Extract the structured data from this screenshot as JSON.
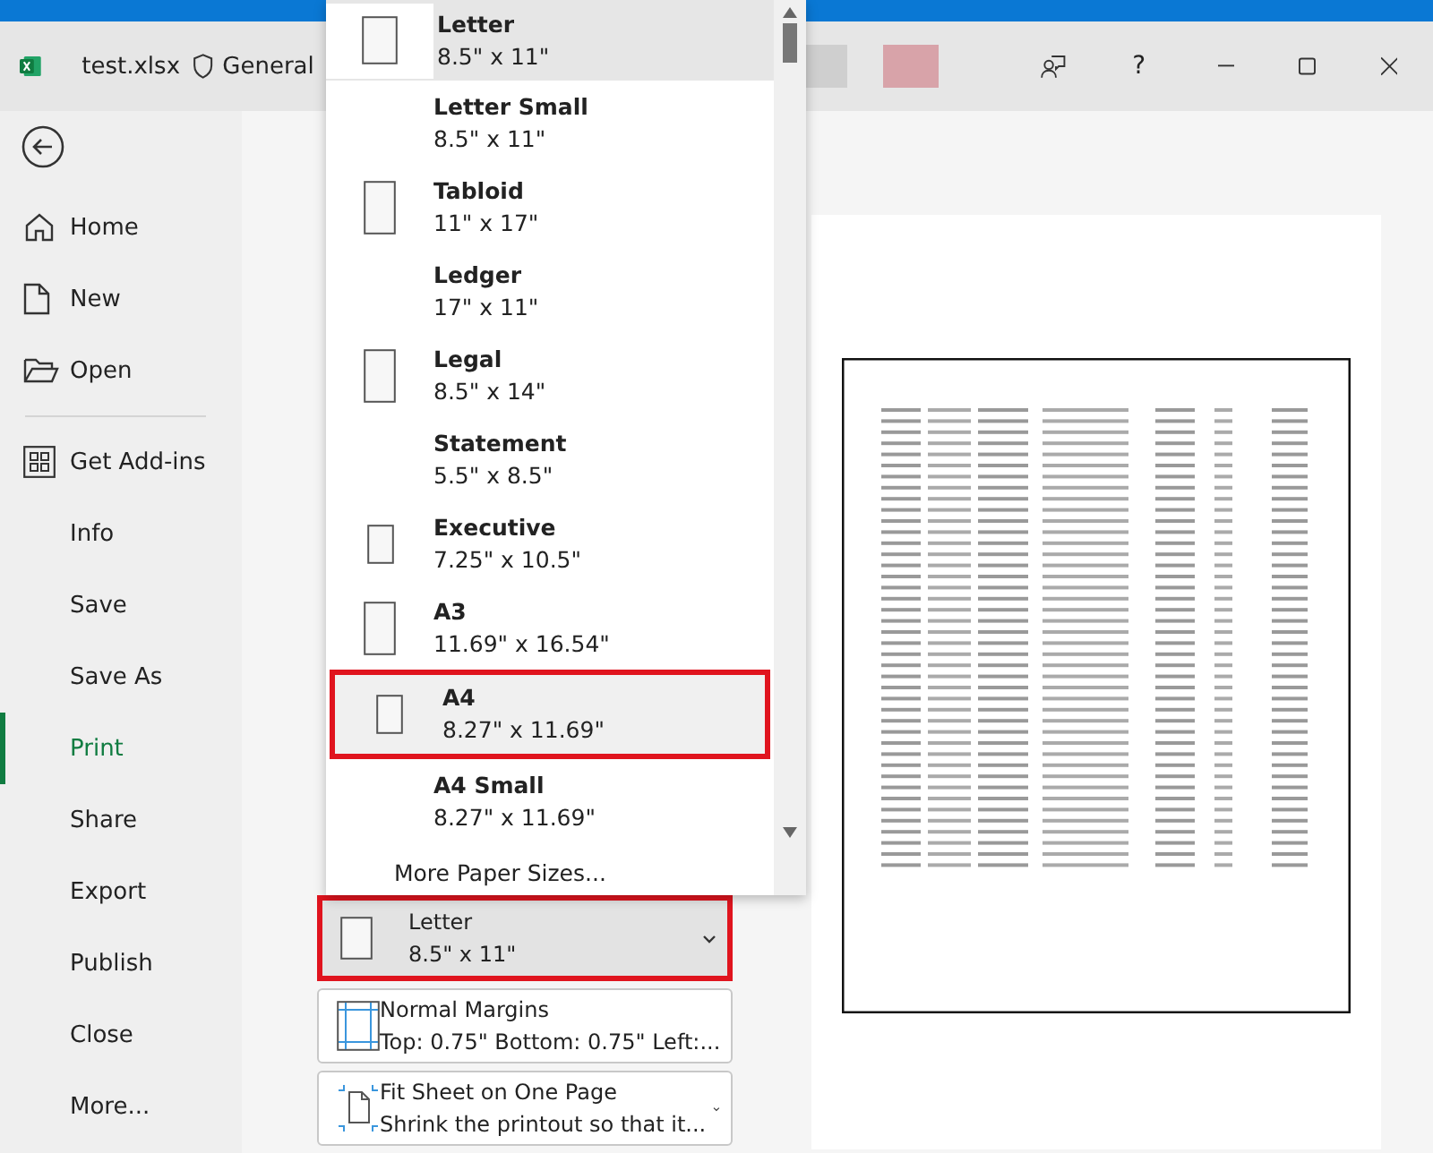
{
  "title_bar": {
    "file_name": "test.xlsx",
    "sensitivity": "General",
    "help": "?"
  },
  "sidebar": {
    "items": [
      {
        "label": "Home",
        "kind": "home",
        "selected": false
      },
      {
        "label": "New",
        "kind": "new",
        "selected": false
      },
      {
        "label": "Open",
        "kind": "open",
        "selected": false
      },
      {
        "label": "Get Add-ins",
        "kind": "addins",
        "selected": false
      },
      {
        "label": "Info",
        "kind": "plain",
        "selected": false
      },
      {
        "label": "Save",
        "kind": "plain",
        "selected": false
      },
      {
        "label": "Save As",
        "kind": "plain",
        "selected": false
      },
      {
        "label": "Print",
        "kind": "plain",
        "selected": true
      },
      {
        "label": "Share",
        "kind": "plain",
        "selected": false
      },
      {
        "label": "Export",
        "kind": "plain",
        "selected": false
      },
      {
        "label": "Publish",
        "kind": "plain",
        "selected": false
      },
      {
        "label": "Close",
        "kind": "plain",
        "selected": false
      },
      {
        "label": "More...",
        "kind": "plain",
        "selected": false
      }
    ]
  },
  "paper_menu": {
    "items": [
      {
        "name": "Letter",
        "size": "8.5\" x 11\"",
        "kind": "portrait",
        "selected": true,
        "highlighted": false
      },
      {
        "name": "Letter Small",
        "size": "8.5\" x 11\"",
        "kind": "none",
        "selected": false,
        "highlighted": false
      },
      {
        "name": "Tabloid",
        "size": "11\" x 17\"",
        "kind": "tall",
        "selected": false,
        "highlighted": false
      },
      {
        "name": "Ledger",
        "size": "17\" x 11\"",
        "kind": "none",
        "selected": false,
        "highlighted": false
      },
      {
        "name": "Legal",
        "size": "8.5\" x 14\"",
        "kind": "tall",
        "selected": false,
        "highlighted": false
      },
      {
        "name": "Statement",
        "size": "5.5\" x 8.5\"",
        "kind": "none",
        "selected": false,
        "highlighted": false
      },
      {
        "name": "Executive",
        "size": "7.25\" x 10.5\"",
        "kind": "small",
        "selected": false,
        "highlighted": false
      },
      {
        "name": "A3",
        "size": "11.69\" x 16.54\"",
        "kind": "tall",
        "selected": false,
        "highlighted": false
      },
      {
        "name": "A4",
        "size": "8.27\" x 11.69\"",
        "kind": "small",
        "selected": false,
        "highlighted": true
      },
      {
        "name": "A4 Small",
        "size": "8.27\" x 11.69\"",
        "kind": "none",
        "selected": false,
        "highlighted": false
      }
    ],
    "more": "More Paper Sizes..."
  },
  "settings": [
    {
      "kind": "paper",
      "title": "Letter",
      "detail": "8.5\" x 11\"",
      "highlighted": true
    },
    {
      "kind": "margins",
      "title": "Normal Margins",
      "detail": "Top: 0.75\" Bottom: 0.75\" Left:...",
      "highlighted": false
    },
    {
      "kind": "scaling",
      "title": "Fit Sheet on One Page",
      "detail": "Shrink the printout so that it...",
      "highlighted": false
    }
  ]
}
